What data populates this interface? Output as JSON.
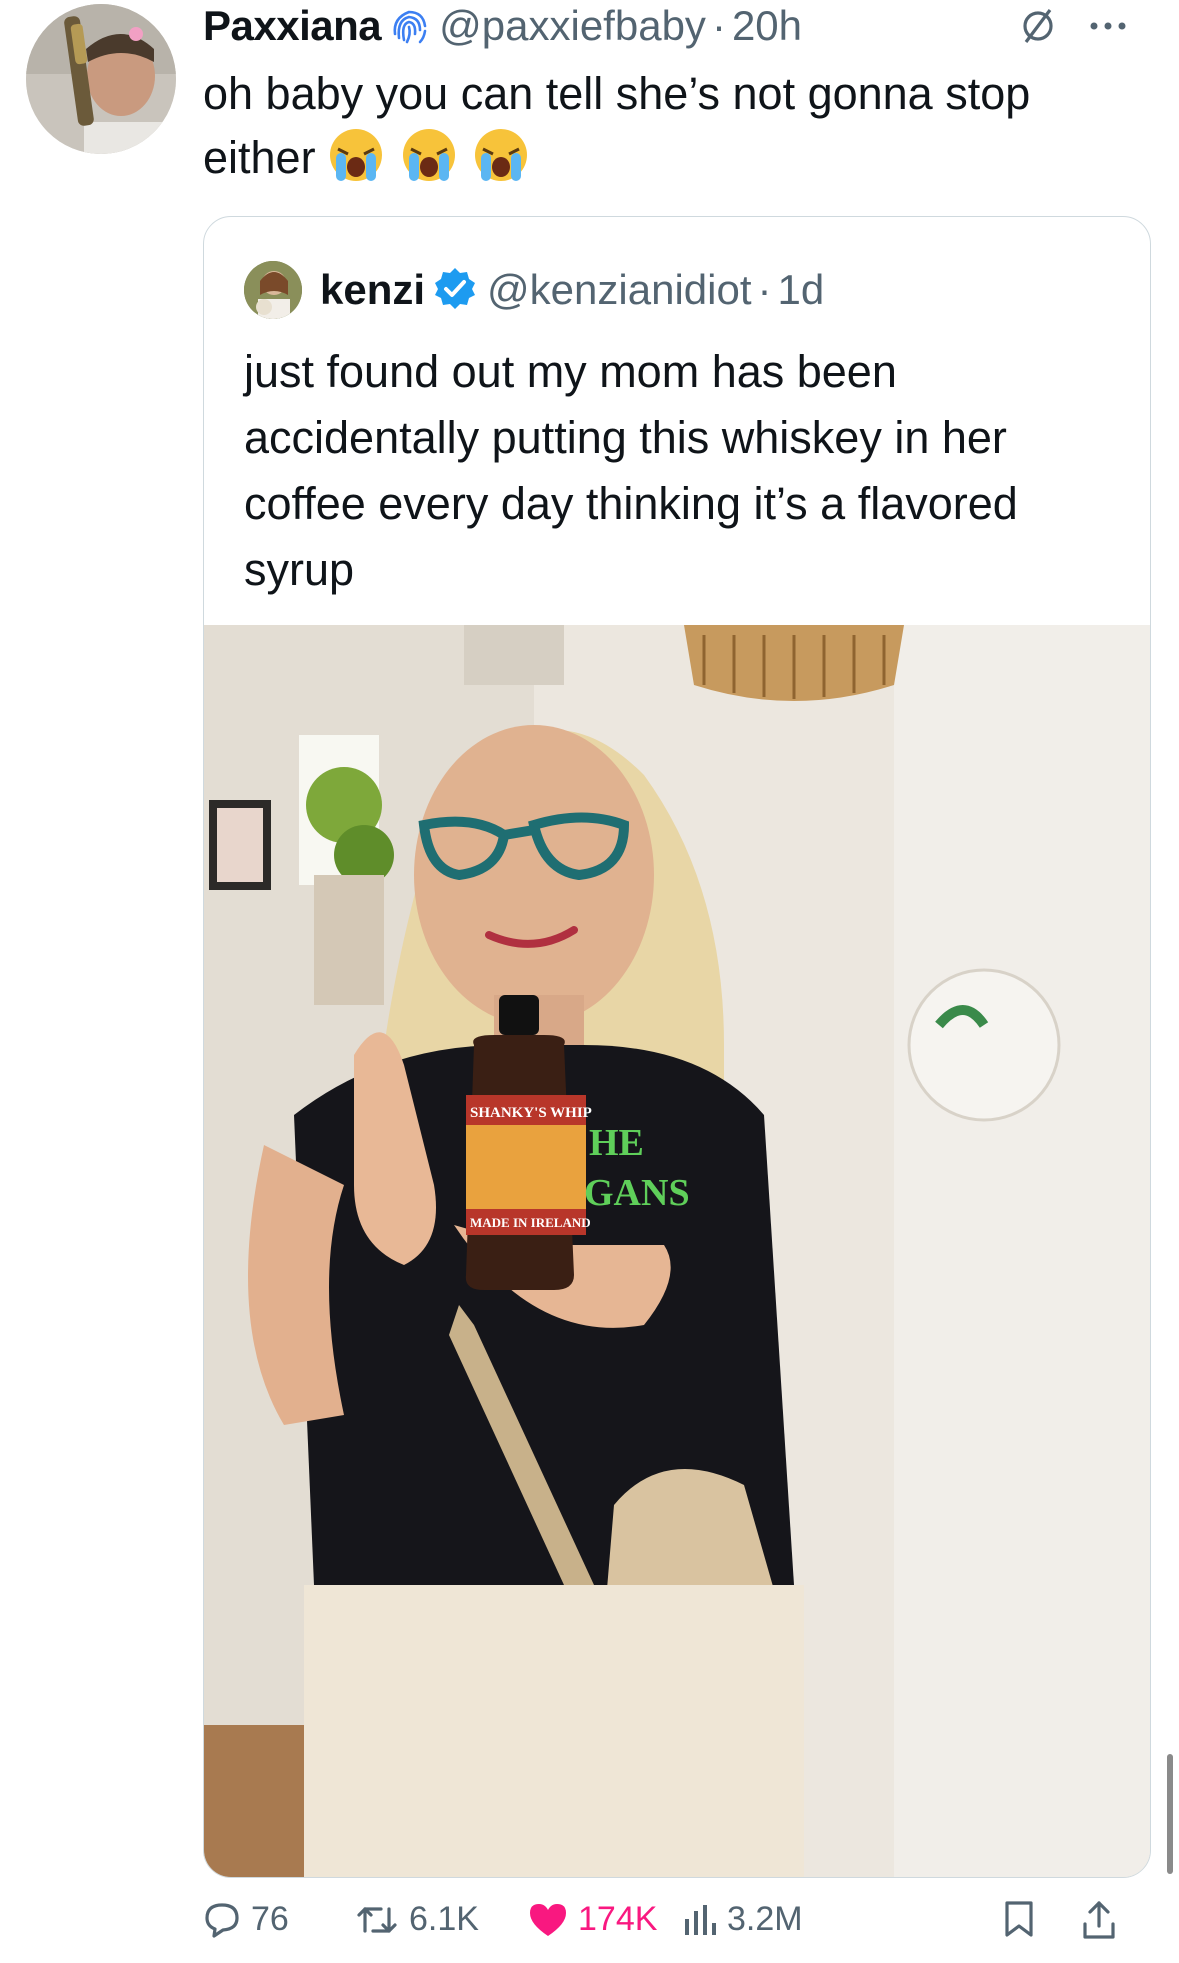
{
  "tweet": {
    "display_name": "Paxxiana",
    "handle": "@paxxiefbaby",
    "separator": "·",
    "time": "20h",
    "text": "oh baby you can tell she’s not gonna stop either"
  },
  "quoted_tweet": {
    "display_name": "kenzi",
    "handle": "@kenzianidiot",
    "separator": "·",
    "time": "1d",
    "text": "just found out my mom has been accidentally putting this whiskey in her coffee every day thinking it’s a flavored syrup",
    "photo": {
      "bottle_label_top": "SHANKY'S WHIP",
      "bottle_label_bottom": "MADE IN IRELAND",
      "shirt_text_1": "HE",
      "shirt_text_2": "GANS"
    }
  },
  "actions": {
    "replies": "76",
    "reposts": "6.1K",
    "likes": "174K",
    "views": "3.2M"
  },
  "colors": {
    "text_primary": "#0f1419",
    "text_secondary": "#536471",
    "like_pink": "#f91880",
    "verified_blue": "#1d9bf0",
    "fingerprint_blue": "#3c7ff2"
  },
  "icons": [
    "fingerprint-icon",
    "no-sign-icon",
    "more-icon",
    "verified-icon",
    "reply-icon",
    "repost-icon",
    "like-icon",
    "views-icon",
    "bookmark-icon",
    "share-icon",
    "crying-emoji"
  ]
}
